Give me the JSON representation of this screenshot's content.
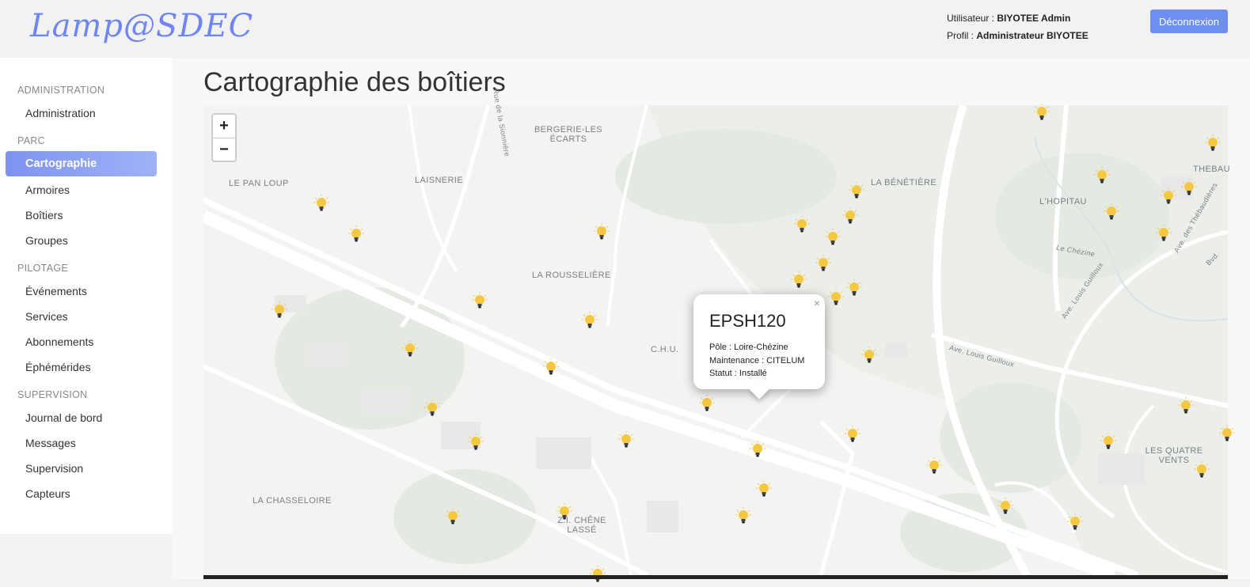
{
  "header": {
    "logo": "Lamp@SDEC",
    "user_label": "Utilisateur :",
    "user_name": "BIYOTEE Admin",
    "profile_label": "Profil :",
    "profile_name": "Administrateur BIYOTEE",
    "logout": "Déconnexion"
  },
  "sidebar": {
    "administration_title": "ADMINISTRATION",
    "administration": "Administration",
    "parc_title": "PARC",
    "cartographie": "Cartographie",
    "armoires": "Armoires",
    "boitiers": "Boîtiers",
    "groupes": "Groupes",
    "pilotage_title": "PILOTAGE",
    "evenements": "Événements",
    "services": "Services",
    "abonnements": "Abonnements",
    "ephemerides": "Éphémérides",
    "supervision_title": "SUPERVISION",
    "journal": "Journal de bord",
    "messages": "Messages",
    "supervision": "Supervision",
    "capteurs": "Capteurs"
  },
  "page": {
    "title": "Cartographie des boîtiers"
  },
  "map": {
    "zoom_in": "+",
    "zoom_out": "−",
    "places": {
      "bergerie": "BERGERIE-LES ÉCARTS",
      "laisnerie": "LAISNERIE",
      "pan_loup": "LE PAN LOUP",
      "rousseliere": "LA ROUSSELIÈRE",
      "chu": "C.H.U.",
      "benetiere": "LA BÉNÉTIÈRE",
      "hopitau": "L'HOPITAU",
      "thebau": "THEBAU",
      "quatre_vents": "LES QUATRE VENTS",
      "chasseloire": "LA CHASSELOIRE",
      "chene_lasse": "Z.I. CHÊNE LASSÉ"
    },
    "streets": {
      "s1": "Rue de la Sionnière",
      "s2": "Ave. Louis Guilloux",
      "s3": "Ave. Louis Guilloux",
      "s4": "Le Chézine",
      "s5": "Ave. des Thébaudières",
      "s6": "Bvd."
    },
    "popup": {
      "title": "EPSH120",
      "pole": "Pôle : Loire-Chézine",
      "maintenance": "Maintenance : CITELUM",
      "statut": "Statut : Installé",
      "close": "×"
    },
    "colors": {
      "bulb": "#f5c842",
      "road": "#ffffff",
      "green": "#e4e9e2"
    }
  }
}
